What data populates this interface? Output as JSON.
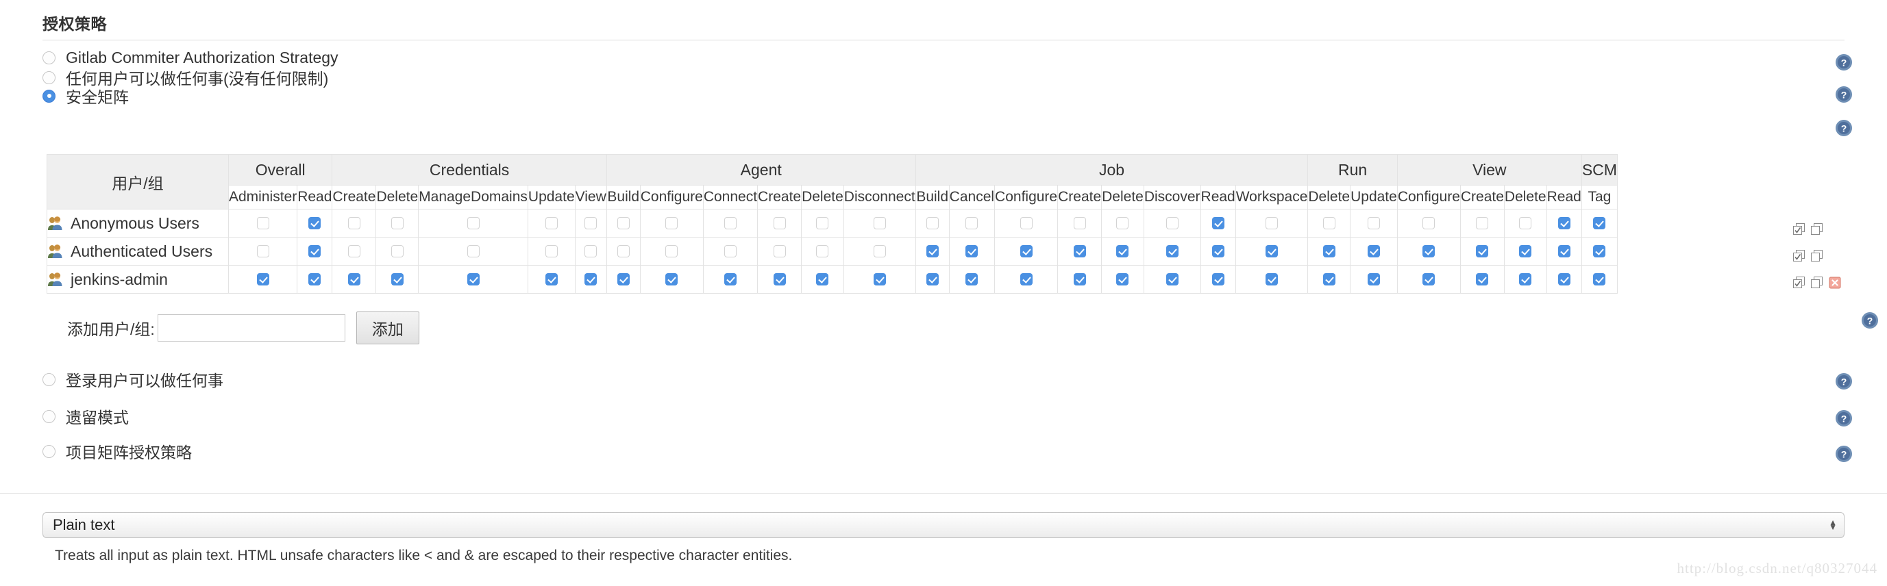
{
  "section": {
    "title": "授权策略"
  },
  "strategies": [
    {
      "label": "Gitlab Commiter Authorization Strategy",
      "checked": false,
      "help": "help-icon"
    },
    {
      "label": "任何用户可以做任何事(没有任何限制)",
      "checked": false,
      "help": "help-icon"
    },
    {
      "label": "安全矩阵",
      "checked": true,
      "help": "help-icon"
    },
    {
      "label": "登录用户可以做任何事",
      "checked": false,
      "help": "help-icon"
    },
    {
      "label": "遗留模式",
      "checked": false,
      "help": "help-icon"
    },
    {
      "label": "项目矩阵授权策略",
      "checked": false,
      "help": "help-icon"
    }
  ],
  "matrix": {
    "user_column_header": "用户/组",
    "groups": [
      {
        "name": "Overall",
        "permissions": [
          "Administer",
          "Read"
        ]
      },
      {
        "name": "Credentials",
        "permissions": [
          "Create",
          "Delete",
          "ManageDomains",
          "Update",
          "View"
        ]
      },
      {
        "name": "Agent",
        "permissions": [
          "Build",
          "Configure",
          "Connect",
          "Create",
          "Delete",
          "Disconnect"
        ]
      },
      {
        "name": "Job",
        "permissions": [
          "Build",
          "Cancel",
          "Configure",
          "Create",
          "Delete",
          "Discover",
          "Read",
          "Workspace"
        ]
      },
      {
        "name": "Run",
        "permissions": [
          "Delete",
          "Update"
        ]
      },
      {
        "name": "View",
        "permissions": [
          "Configure",
          "Create",
          "Delete",
          "Read"
        ]
      },
      {
        "name": "SCM",
        "permissions": [
          "Tag"
        ]
      }
    ],
    "rows": [
      {
        "user": "Anonymous Users",
        "icon": "users-icon",
        "values": [
          false,
          true,
          false,
          false,
          false,
          false,
          false,
          false,
          false,
          false,
          false,
          false,
          false,
          false,
          false,
          false,
          false,
          false,
          false,
          true,
          false,
          false,
          false,
          false,
          false,
          false,
          true,
          true
        ],
        "actions": [
          "select-all-icon",
          "unselect-all-icon"
        ]
      },
      {
        "user": "Authenticated Users",
        "icon": "users-icon",
        "values": [
          false,
          true,
          false,
          false,
          false,
          false,
          false,
          false,
          false,
          false,
          false,
          false,
          false,
          true,
          true,
          true,
          true,
          true,
          true,
          true,
          true,
          true,
          true,
          true,
          true,
          true,
          true,
          true
        ],
        "actions": [
          "select-all-icon",
          "unselect-all-icon"
        ]
      },
      {
        "user": "jenkins-admin",
        "icon": "users-icon",
        "values": [
          true,
          true,
          true,
          true,
          true,
          true,
          true,
          true,
          true,
          true,
          true,
          true,
          true,
          true,
          true,
          true,
          true,
          true,
          true,
          true,
          true,
          true,
          true,
          true,
          true,
          true,
          true,
          true
        ],
        "actions": [
          "select-all-icon",
          "unselect-all-icon",
          "delete-row-icon"
        ]
      }
    ]
  },
  "add_user": {
    "label": "添加用户/组:",
    "value": "",
    "placeholder": "",
    "button_label": "添加",
    "help": "help-icon"
  },
  "footer": {
    "markup_formatter": "Plain text",
    "description": "Treats all input as plain text. HTML unsafe characters like < and & are escaped to their respective character entities.",
    "watermark": "http://blog.csdn.net/q80327044"
  },
  "colors": {
    "accent": "#4a90e2",
    "header_bg": "#efefef",
    "border": "#e3e3e3",
    "delete_icon": "#e88a7d"
  }
}
